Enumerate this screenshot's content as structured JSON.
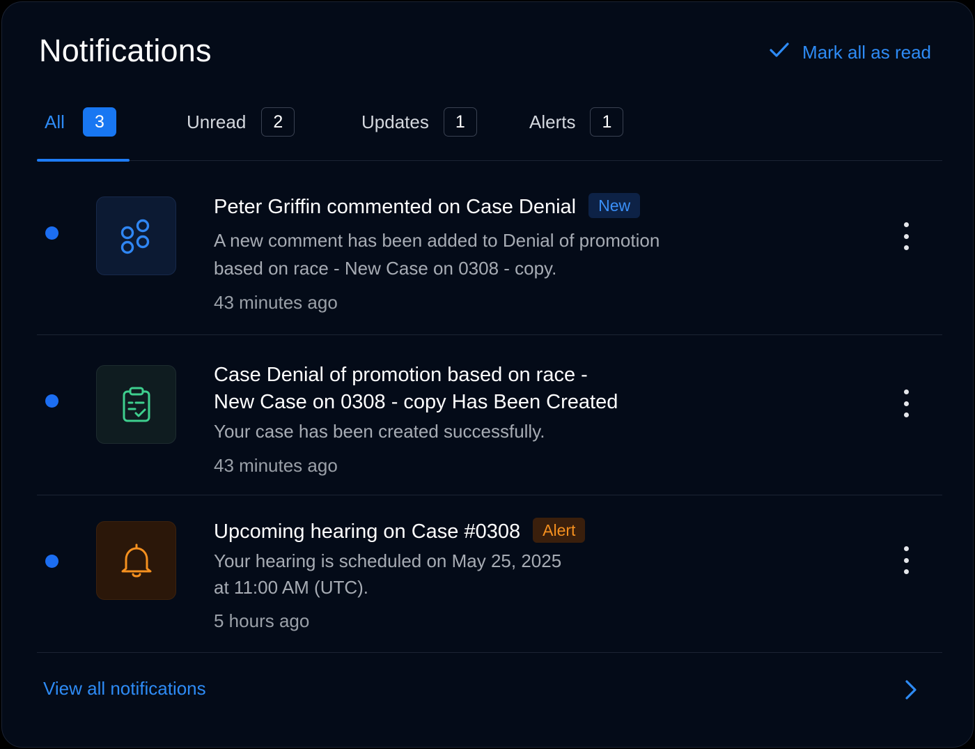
{
  "header": {
    "title": "Notifications",
    "mark_all_label": "Mark all as read"
  },
  "tabs": [
    {
      "label": "All",
      "count": "3",
      "active": true
    },
    {
      "label": "Unread",
      "count": "2",
      "active": false
    },
    {
      "label": "Updates",
      "count": "1",
      "active": false
    },
    {
      "label": "Alerts",
      "count": "1",
      "active": false
    }
  ],
  "notifications": [
    {
      "icon": "share-nodes-icon",
      "title": "Peter Griffin commented on Case Denial",
      "badge": "New",
      "description_lines": [
        "A new comment has been added to Denial of promotion",
        "based on race - New Case on 0308 - copy."
      ],
      "time": "43 minutes ago",
      "unread": true
    },
    {
      "icon": "clipboard-check-icon",
      "title_lines": [
        "Case Denial of promotion based on race -",
        "New Case on 0308 - copy Has Been Created"
      ],
      "description": "Your case has been created successfully.",
      "time": "43 minutes ago",
      "unread": true
    },
    {
      "icon": "bell-icon",
      "title": "Upcoming hearing on Case #0308",
      "badge": "Alert",
      "description_lines": [
        "Your hearing is scheduled on May 25, 2025",
        "at 11:00 AM (UTC)."
      ],
      "time": "5 hours ago",
      "unread": true
    }
  ],
  "footer": {
    "view_all_label": "View all notifications"
  },
  "colors": {
    "accent": "#1e7cf5",
    "background": "#040b18",
    "new_badge": "#3a8ff7",
    "alert_badge": "#f5901f",
    "success_icon": "#3ecf8e"
  }
}
